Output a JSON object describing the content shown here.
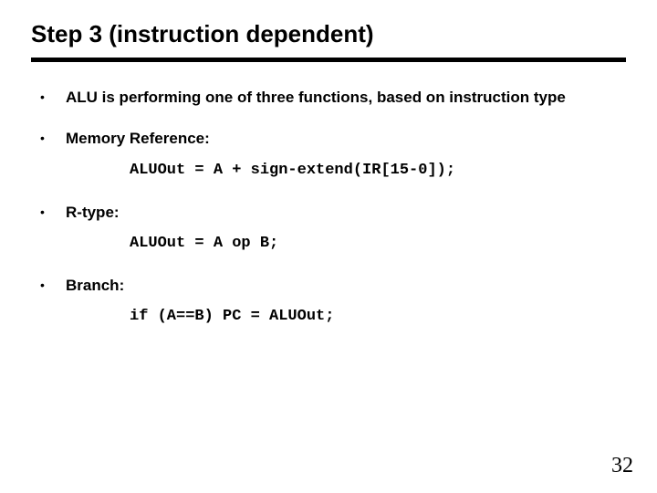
{
  "title": "Step 3 (instruction dependent)",
  "bullets": {
    "intro": "ALU is performing one of three functions, based on instruction type",
    "memref_label": "Memory Reference:",
    "memref_code": "ALUOut = A + sign-extend(IR[15-0]);",
    "rtype_label": "R-type:",
    "rtype_code": "ALUOut = A op B;",
    "branch_label": "Branch:",
    "branch_code": "if (A==B) PC = ALUOut;"
  },
  "page_number": "32"
}
